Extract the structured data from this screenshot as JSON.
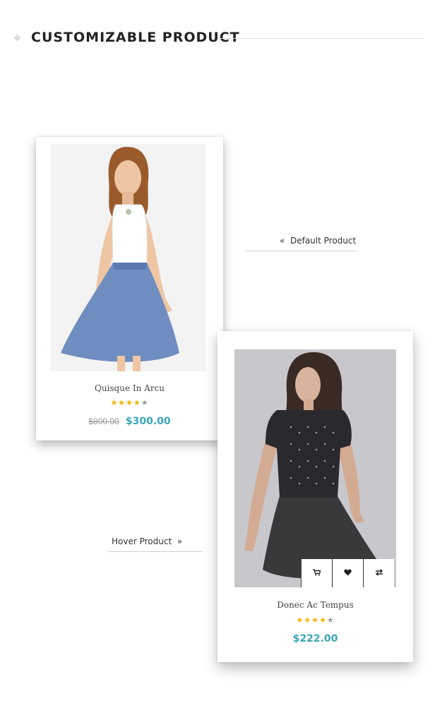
{
  "header": {
    "title": "CUSTOMIZABLE PRODUCT"
  },
  "default_link": {
    "label": "Default Product",
    "arrow": "«"
  },
  "hover_link": {
    "label": "Hover Product",
    "arrow": "»"
  },
  "products": [
    {
      "name": "Quisque In Arcu",
      "rating": 4,
      "max_rating": 5,
      "old_price": "$800.00",
      "price": "$300.00"
    },
    {
      "name": "Donec Ac Tempus",
      "rating": 4,
      "max_rating": 5,
      "price": "$222.00",
      "actions": [
        {
          "icon": "cart-icon"
        },
        {
          "icon": "heart-icon"
        },
        {
          "icon": "compare-icon"
        }
      ]
    }
  ],
  "colors": {
    "accent": "#3aa6b9",
    "star": "#f4b400"
  }
}
